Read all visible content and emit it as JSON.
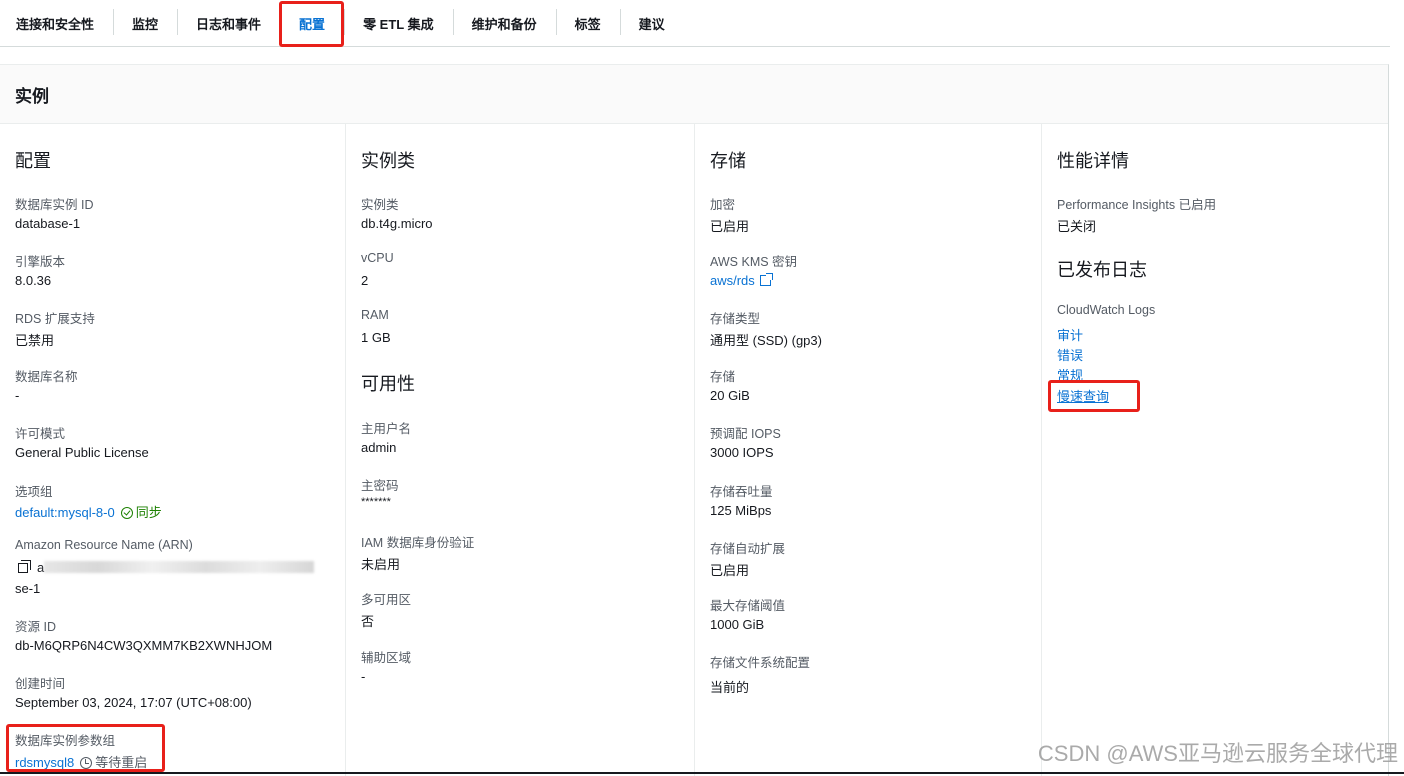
{
  "tabs": [
    {
      "label": "连接和安全性",
      "active": false
    },
    {
      "label": "监控",
      "active": false
    },
    {
      "label": "日志和事件",
      "active": false
    },
    {
      "label": "配置",
      "active": true
    },
    {
      "label": "零 ETL 集成",
      "active": false
    },
    {
      "label": "维护和备份",
      "active": false
    },
    {
      "label": "标签",
      "active": false
    },
    {
      "label": "建议",
      "active": false
    }
  ],
  "panel": {
    "title": "实例"
  },
  "config": {
    "title": "配置",
    "db_instance_id": {
      "label": "数据库实例 ID",
      "value": "database-1"
    },
    "engine_version": {
      "label": "引擎版本",
      "value": "8.0.36"
    },
    "rds_extended_support": {
      "label": "RDS 扩展支持",
      "value": "已禁用"
    },
    "db_name": {
      "label": "数据库名称",
      "value": "-"
    },
    "license_model": {
      "label": "许可模式",
      "value": "General Public License"
    },
    "option_group": {
      "label": "选项组",
      "value": "default:mysql-8-0",
      "status": "同步"
    },
    "arn": {
      "label": "Amazon Resource Name (ARN)",
      "value_prefix": "a",
      "value_suffix": "se-1"
    },
    "resource_id": {
      "label": "资源 ID",
      "value": "db-M6QRP6N4CW3QXMM7KB2XWNHJOM"
    },
    "created_time": {
      "label": "创建时间",
      "value": "September 03, 2024, 17:07 (UTC+08:00)"
    },
    "param_group": {
      "label": "数据库实例参数组",
      "value": "rdsmysql8",
      "status": "等待重启"
    }
  },
  "instance_class": {
    "title": "实例类",
    "class": {
      "label": "实例类",
      "value": "db.t4g.micro"
    },
    "vcpu": {
      "label": "vCPU",
      "value": "2"
    },
    "ram": {
      "label": "RAM",
      "value": "1 GB"
    }
  },
  "availability": {
    "title": "可用性",
    "master_user": {
      "label": "主用户名",
      "value": "admin"
    },
    "master_password": {
      "label": "主密码",
      "value": "*******"
    },
    "iam_auth": {
      "label": "IAM 数据库身份验证",
      "value": "未启用"
    },
    "multi_az": {
      "label": "多可用区",
      "value": "否"
    },
    "secondary_zone": {
      "label": "辅助区域",
      "value": "-"
    }
  },
  "storage": {
    "title": "存储",
    "encryption": {
      "label": "加密",
      "value": "已启用"
    },
    "kms_key": {
      "label": "AWS KMS 密钥",
      "value": "aws/rds"
    },
    "storage_type": {
      "label": "存储类型",
      "value": "通用型 (SSD) (gp3)"
    },
    "storage": {
      "label": "存储",
      "value": "20 GiB"
    },
    "iops": {
      "label": "预调配 IOPS",
      "value": "3000 IOPS"
    },
    "throughput": {
      "label": "存储吞吐量",
      "value": "125 MiBps"
    },
    "autoscaling": {
      "label": "存储自动扩展",
      "value": "已启用"
    },
    "max_threshold": {
      "label": "最大存储阈值",
      "value": "1000 GiB"
    },
    "fs_config": {
      "label": "存储文件系统配置",
      "value": "当前的"
    }
  },
  "performance": {
    "title": "性能详情",
    "pi": {
      "label": "Performance Insights 已启用",
      "value": "已关闭"
    }
  },
  "published_logs": {
    "title": "已发布日志",
    "label": "CloudWatch Logs",
    "items": [
      "审计",
      "错误",
      "常规",
      "慢速查询"
    ]
  },
  "watermark": "CSDN @AWS亚马逊云服务全球代理",
  "colors": {
    "link": "#0972d3",
    "highlight": "#e8201a",
    "success": "#1d8102"
  }
}
